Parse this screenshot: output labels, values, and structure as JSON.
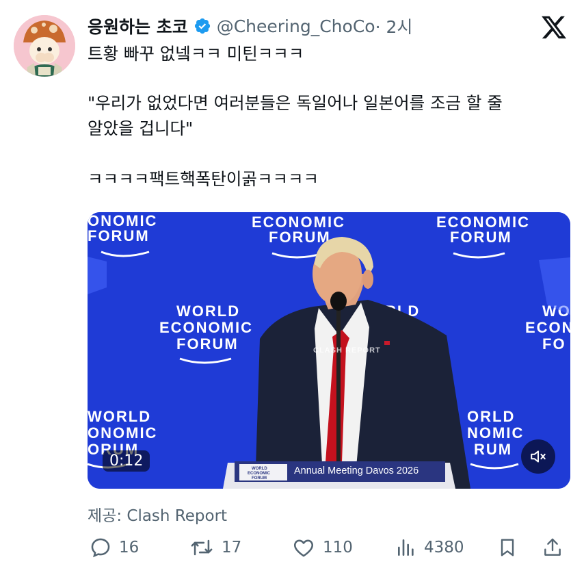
{
  "author": {
    "display_name": "응원하는 초코",
    "handle": "@Cheering_ChoCo",
    "time": " · 2시",
    "verified": true
  },
  "tweet": {
    "line1": "트황 빠꾸 없넼ㅋㅋ 미틴ㅋㅋㅋ",
    "quote_line1": "\"우리가 없었다면 여러분들은 독일어나 일본어를 조금 할 줄",
    "quote_line2": "알았을 겁니다\"",
    "line3": "ㅋㅋㅋㅋ팩트핵폭탄이곩ㅋㅋㅋㅋ"
  },
  "media": {
    "video_time": "0:12",
    "podium_text": "Annual Meeting Davos 2026",
    "podium_logo": "WORLD ECONOMIC FORUM",
    "watermark": "CLASH REPORT",
    "backdrop_text": [
      "WORLD",
      "ECONOMIC",
      "FORUM"
    ]
  },
  "source": "제공: Clash Report",
  "actions": {
    "replies": "16",
    "retweets": "17",
    "likes": "110",
    "views": "4380"
  },
  "colors": {
    "backdrop_blue": "#1f3bd6",
    "text_primary": "#0f1419",
    "text_secondary": "#536471",
    "verified_blue": "#1d9bf0",
    "avatar_bg": "#f6c6cf"
  }
}
